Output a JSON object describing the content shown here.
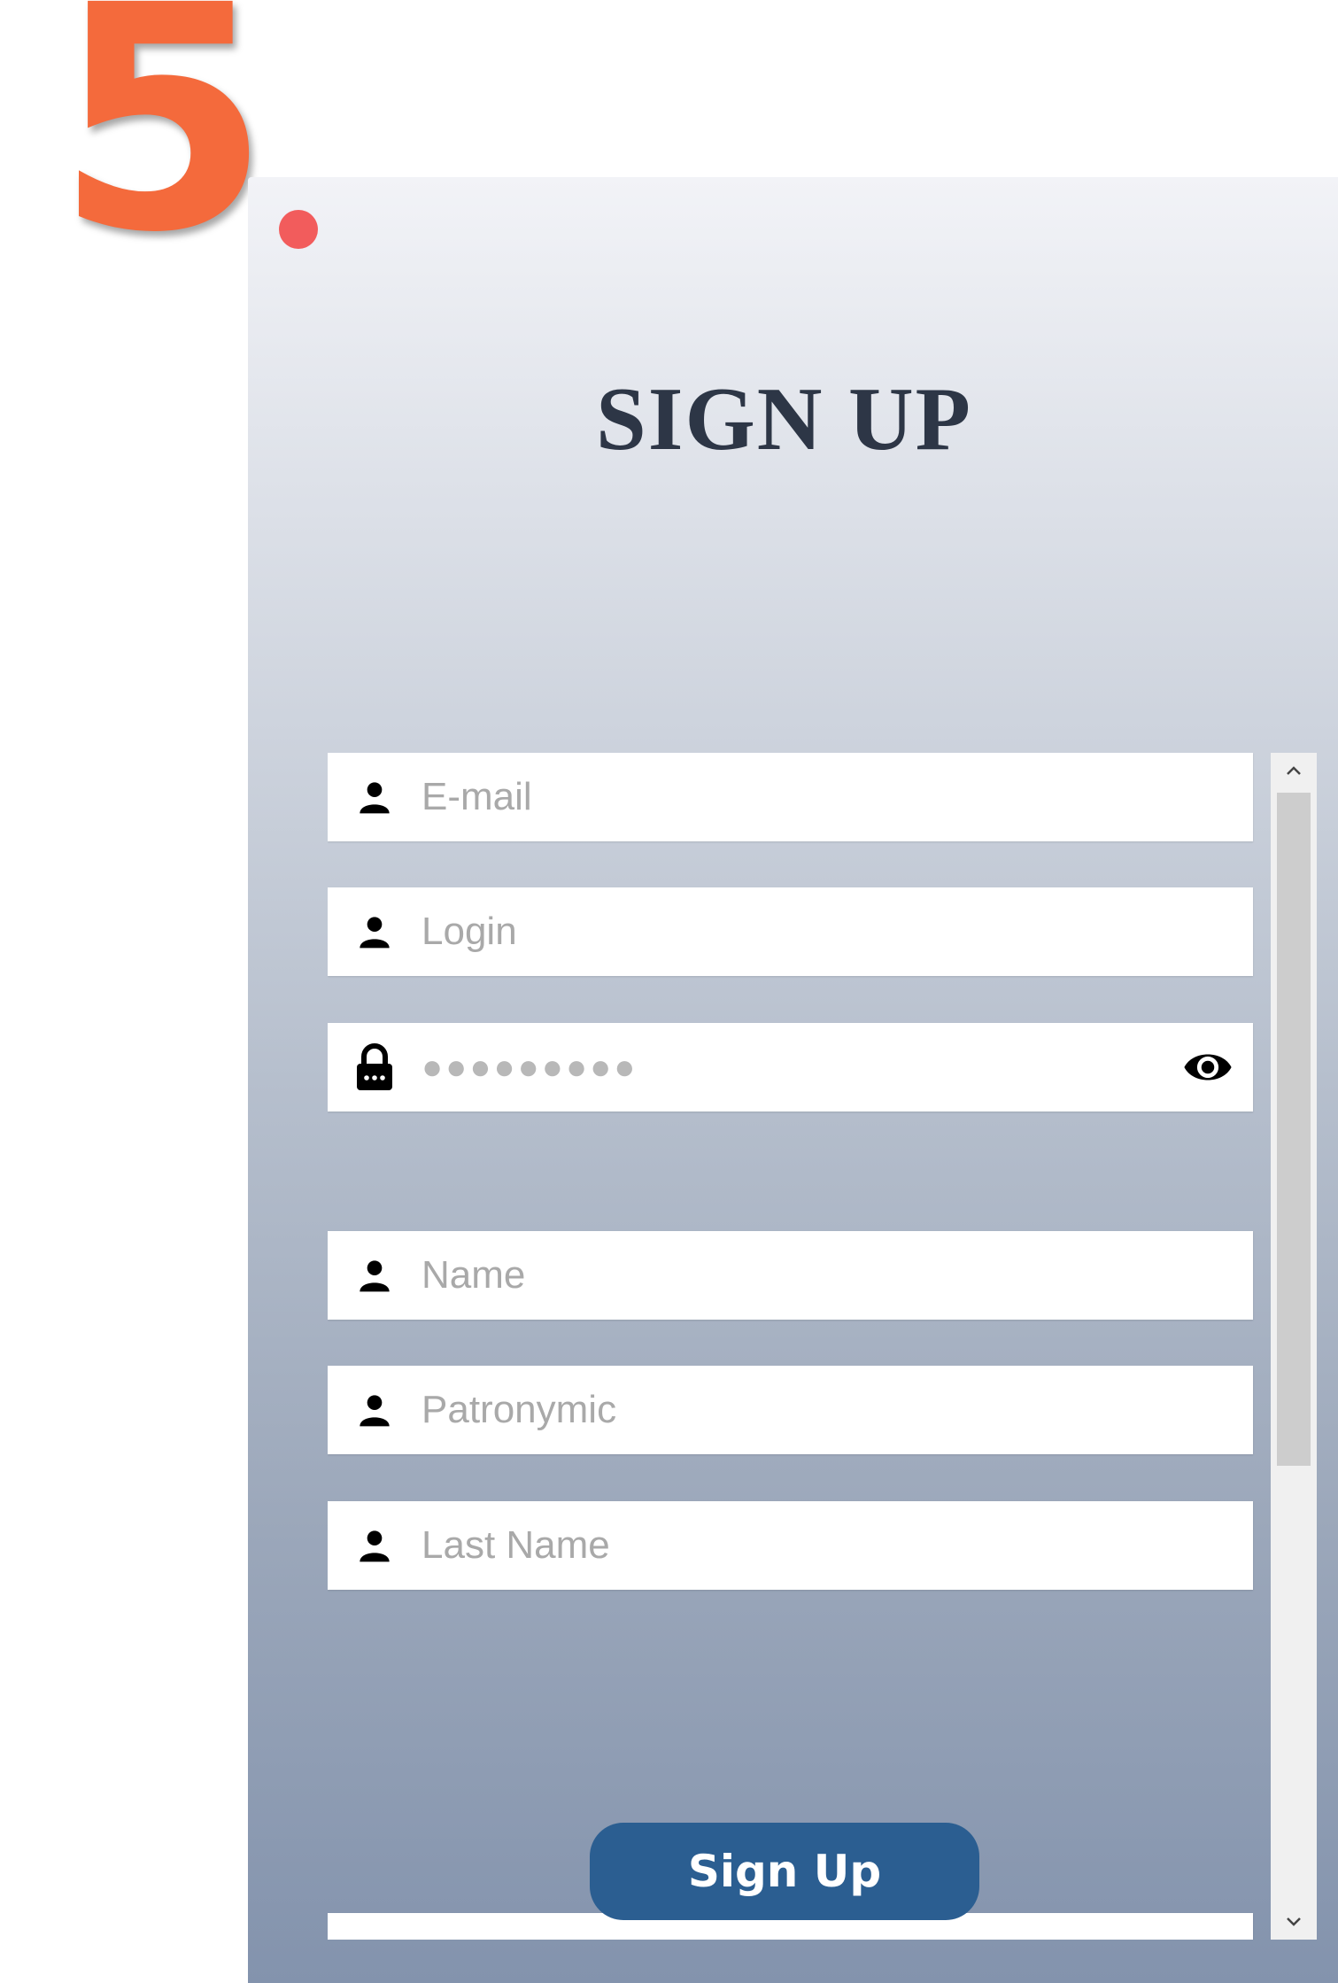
{
  "step_badge": "5",
  "form": {
    "title": "SIGN UP",
    "fields": {
      "email": "E-mail",
      "login": "Login",
      "password_mask": "●●●●●●●●●",
      "name": "Name",
      "patronymic": "Patronymic",
      "last_name": "Last Name"
    },
    "submit_label": "Sign Up"
  },
  "colors": {
    "accent": "#2b5e91",
    "close_dot": "#f25c5c",
    "badge": "#f46a3c"
  },
  "icons": {
    "user": "user-icon",
    "lock": "lock-icon",
    "eye": "eye-icon"
  }
}
